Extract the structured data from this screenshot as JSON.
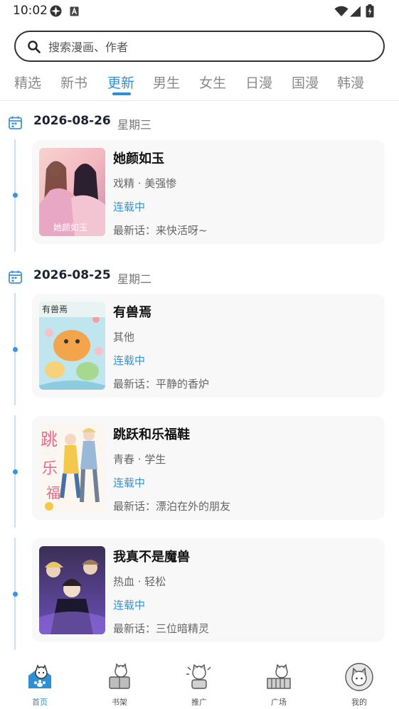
{
  "status_bar": {
    "time": "10:02"
  },
  "search": {
    "placeholder": "搜索漫画、作者"
  },
  "tabs": [
    {
      "label": "精选"
    },
    {
      "label": "新书"
    },
    {
      "label": "更新",
      "active": true
    },
    {
      "label": "男生"
    },
    {
      "label": "女生"
    },
    {
      "label": "日漫"
    },
    {
      "label": "国漫"
    },
    {
      "label": "韩漫"
    }
  ],
  "days": [
    {
      "date": "2026-08-26",
      "weekday": "星期三",
      "items": [
        {
          "title": "她颜如玉",
          "tags": "戏精 · 美强惨",
          "status": "连载中",
          "latest": "最新话：来快活呀~"
        }
      ]
    },
    {
      "date": "2026-08-25",
      "weekday": "星期二",
      "items": [
        {
          "title": "有兽焉",
          "tags": "其他",
          "status": "连载中",
          "latest": "最新话：平静的香炉"
        },
        {
          "title": "跳跃和乐福鞋",
          "tags": "青春 · 学生",
          "status": "连载中",
          "latest": "最新话：漂泊在外的朋友"
        },
        {
          "title": "我真不是魔兽",
          "tags": "热血 · 轻松",
          "status": "连载中",
          "latest": "最新话：三位暗精灵"
        }
      ]
    }
  ],
  "bottom_nav": [
    {
      "label": "首页",
      "active": true
    },
    {
      "label": "书架"
    },
    {
      "label": "推广"
    },
    {
      "label": "广场"
    },
    {
      "label": "我的"
    }
  ],
  "colors": {
    "accent": "#2f8fd6",
    "timeline": "#c9e1f4",
    "card_bg": "#f8f8f8"
  },
  "icons": [
    "wifi-icon",
    "signal-icon",
    "battery-icon",
    "search-icon",
    "calendar-icon",
    "home-icon",
    "bookshelf-icon",
    "promote-icon",
    "plaza-icon",
    "profile-icon"
  ]
}
